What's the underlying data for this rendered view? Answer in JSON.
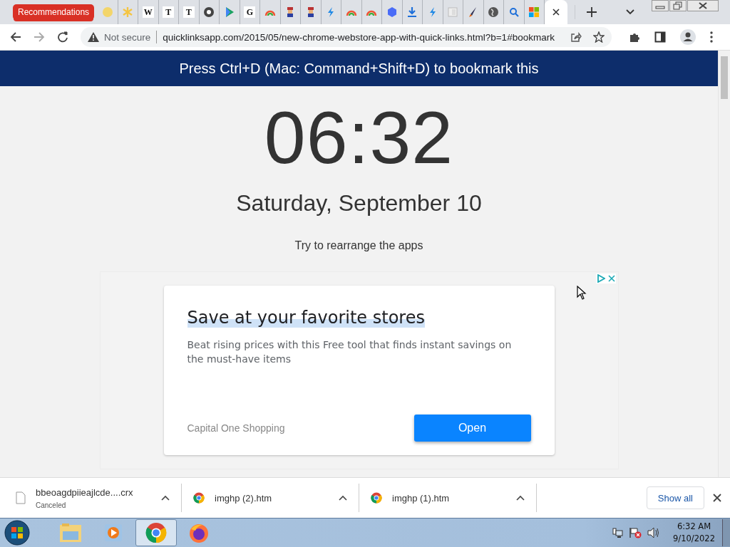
{
  "tabs": [
    {
      "kind": "label",
      "label": "Recommendations",
      "selected": false
    },
    {
      "kind": "icon",
      "selected": false
    },
    {
      "kind": "icon",
      "selected": false
    },
    {
      "kind": "glyph",
      "glyph": "W",
      "selected": false
    },
    {
      "kind": "glyph",
      "glyph": "T",
      "selected": false
    },
    {
      "kind": "glyph",
      "glyph": "T",
      "selected": false
    },
    {
      "kind": "icon",
      "selected": false
    },
    {
      "kind": "icon",
      "selected": false
    },
    {
      "kind": "glyph",
      "glyph": "G",
      "selected": false
    },
    {
      "kind": "icon",
      "selected": false
    },
    {
      "kind": "icon",
      "selected": false
    },
    {
      "kind": "icon",
      "selected": false
    },
    {
      "kind": "icon",
      "selected": false
    },
    {
      "kind": "icon",
      "selected": false
    },
    {
      "kind": "icon",
      "selected": false
    },
    {
      "kind": "icon",
      "selected": false
    },
    {
      "kind": "icon",
      "selected": false
    },
    {
      "kind": "icon",
      "selected": false
    },
    {
      "kind": "icon",
      "selected": false
    },
    {
      "kind": "icon",
      "selected": false
    },
    {
      "kind": "icon",
      "selected": false
    },
    {
      "kind": "icon",
      "selected": false
    },
    {
      "kind": "icon",
      "selected": false
    },
    {
      "kind": "blank",
      "selected": true
    }
  ],
  "address_bar": {
    "security": "Not secure",
    "url": "quicklinksapp.com/2015/05/new-chrome-webstore-app-with-quick-links.html?b=1#bookmark"
  },
  "banner": "Press Ctrl+D (Mac: Command+Shift+D) to bookmark this",
  "clock": {
    "time": "06:32",
    "date": "Saturday, September 10"
  },
  "hint": "Try to rearrange the apps",
  "ad": {
    "headline": "Save at your favorite stores",
    "body": "Beat rising prices with this Free tool that finds instant savings on the must-have items",
    "advertiser": "Capital One Shopping",
    "button": "Open"
  },
  "downloads": [
    {
      "kind": "file",
      "name": "bbeoagdpiieajlcde....crx",
      "status": "Canceled"
    },
    {
      "kind": "web",
      "name": "imghp (2).htm"
    },
    {
      "kind": "web",
      "name": "imghp (1).htm"
    }
  ],
  "show_all": "Show all",
  "taskbar": {
    "apps": [
      {
        "selected": false
      },
      {
        "selected": false
      },
      {
        "selected": true
      },
      {
        "selected": false
      }
    ],
    "time": "6:32 AM",
    "date": "9/10/2022"
  }
}
